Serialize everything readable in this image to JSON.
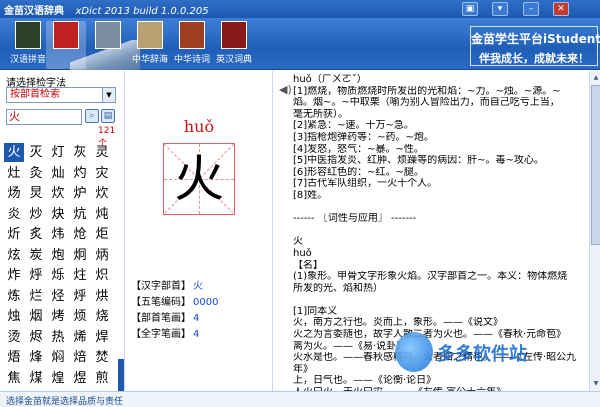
{
  "window": {
    "title": "金苗汉语辞典",
    "version": "xDict 2013  build 1.0.0.205"
  },
  "toolbar": {
    "items": [
      {
        "label": "汉语拼音",
        "icon": "pinyin-book-icon",
        "color": "#2d3e2a"
      },
      {
        "label": "",
        "icon": "red-book-icon",
        "color": "#c02020"
      },
      {
        "label": "",
        "icon": "photo-book-icon",
        "color": "#7c8fa0"
      },
      {
        "label": "中华辞海",
        "icon": "cihai-book-icon",
        "color": "#b8a070"
      },
      {
        "label": "中华诗词",
        "icon": "poetry-book-icon",
        "color": "#a04020"
      },
      {
        "label": "英汉词典",
        "icon": "english-dict-icon",
        "color": "#8a1a1a"
      }
    ],
    "banner": {
      "line1": "金苗学生平台iStudent",
      "line2": "伴我成长，成就未来！"
    }
  },
  "left": {
    "method_label": "请选择检字法",
    "method_value": "按部首检索",
    "search_value": "火",
    "count": "121个",
    "chars": [
      "火",
      "灭",
      "灯",
      "灰",
      "灵",
      "灶",
      "灸",
      "灿",
      "灼",
      "灾",
      "炀",
      "炅",
      "炊",
      "炉",
      "炊",
      "炎",
      "炒",
      "炔",
      "炕",
      "炖",
      "炘",
      "炙",
      "炜",
      "炝",
      "炬",
      "炫",
      "炭",
      "炮",
      "炯",
      "炳",
      "炸",
      "烀",
      "烁",
      "炷",
      "炽",
      "炼",
      "烂",
      "烃",
      "烀",
      "烘",
      "烛",
      "烟",
      "烤",
      "烦",
      "烧",
      "烫",
      "烬",
      "热",
      "烯",
      "焊",
      "焐",
      "烽",
      "焖",
      "焙",
      "焚",
      "焦",
      "煤",
      "煌",
      "煜",
      "煎"
    ]
  },
  "middle": {
    "pinyin": "huǒ",
    "char": "火",
    "info": [
      {
        "key": "【汉字部首】",
        "value": "火"
      },
      {
        "key": "【五笔编码】",
        "value": "0000"
      },
      {
        "key": "【部首笔画】",
        "value": "4"
      },
      {
        "key": "【全字笔画】",
        "value": "4"
      }
    ]
  },
  "right": {
    "lines": [
      "huǒ（ㄏㄨㄛˇ）",
      "[1]燃烧，物质燃烧时所发出的光和焰：~力。~烛。~源。~",
      "焰。烟~。~中取栗（喻为别人冒险出力，而自己吃亏上当，",
      "毫无所获）。",
      "[2]紧急：~速。十万~急。",
      "[3]指枪炮弹药等：~药。~炮。",
      "[4]发怒，怒气：~暴。~性。",
      "[5]中医指发炎、红肿、烦躁等的病因：肝~。毒~攻心。",
      "[6]形容红色的：~红。~腿。",
      "[7]古代军队组织，一火十个人。",
      "[8]姓。",
      "",
      "------ 〖词性与应用〗 -------",
      "",
      "火",
      "huǒ",
      "【名】",
      "(1)象形。甲骨文字形象火焰。汉字部首之一。本义：物体燃烧",
      "所发的光、焰和热）",
      "",
      "[1]同本义",
      "火，南方之行也。炎而上，象形。——《说文》",
      "火之为言委随也，故字人散二者为火也。——《春秋·元命苞》",
      "离为火。——《易·说卦》",
      "火水是也。——春秋感精符。火者阳之精也。——《左传·昭公九",
      "年》",
      "上，日气也。——《论衡·论日》",
      "人火曰火，天火曰灾。——《左传·宣公十六年》"
    ],
    "watermark": "多多软件站"
  },
  "status": {
    "text": "选择金苗就是选择品质与责任"
  }
}
